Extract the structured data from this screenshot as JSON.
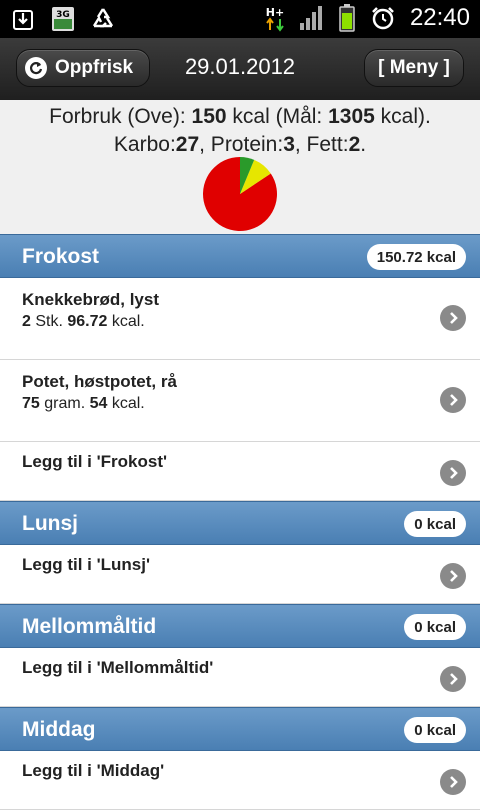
{
  "status_bar": {
    "network": "3G",
    "data_indicator": "H+",
    "time": "22:40",
    "icons": [
      "download-icon",
      "sim-3g-icon",
      "recycle-icon",
      "hplus-data-icon",
      "signal-icon",
      "battery-icon",
      "alarm-icon"
    ]
  },
  "header": {
    "refresh_label": "Oppfrisk",
    "date": "29.01.2012",
    "menu_label": "[ Meny ]"
  },
  "summary": {
    "line1_prefix": "Forbruk (Ove): ",
    "consumed": "150",
    "line1_mid": " kcal (Mål: ",
    "goal": "1305",
    "line1_suffix": " kcal).",
    "carbs_label": "Karbo:",
    "carbs": "27",
    "protein_label": ", Protein:",
    "protein": "3",
    "fat_label": ", Fett:",
    "fat": "2",
    "fat_suffix": ".",
    "pie": {
      "slices": [
        {
          "label": "Karbo",
          "value": 27,
          "color": "#e00000"
        },
        {
          "label": "Protein",
          "value": 3,
          "color": "#e6e600"
        },
        {
          "label": "Fett",
          "value": 2,
          "color": "#2a9a2a"
        }
      ]
    }
  },
  "sections": [
    {
      "title": "Frokost",
      "kcal": "150.72 kcal",
      "items": [
        {
          "name": "Knekkebrød, lyst",
          "qty": "2",
          "unit": " Stk. ",
          "kcal": "96.72",
          "kcal_unit": " kcal."
        },
        {
          "name": "Potet, høstpotet, rå",
          "qty": "75",
          "unit": " gram. ",
          "kcal": "54",
          "kcal_unit": " kcal."
        }
      ],
      "add_label": "Legg til i 'Frokost'"
    },
    {
      "title": "Lunsj",
      "kcal": "0 kcal",
      "add_label": "Legg til i 'Lunsj'"
    },
    {
      "title": "Mellommåltid",
      "kcal": "0 kcal",
      "add_label": "Legg til i 'Mellommåltid'"
    },
    {
      "title": "Middag",
      "kcal": "0 kcal",
      "add_label": "Legg til i 'Middag'"
    }
  ]
}
